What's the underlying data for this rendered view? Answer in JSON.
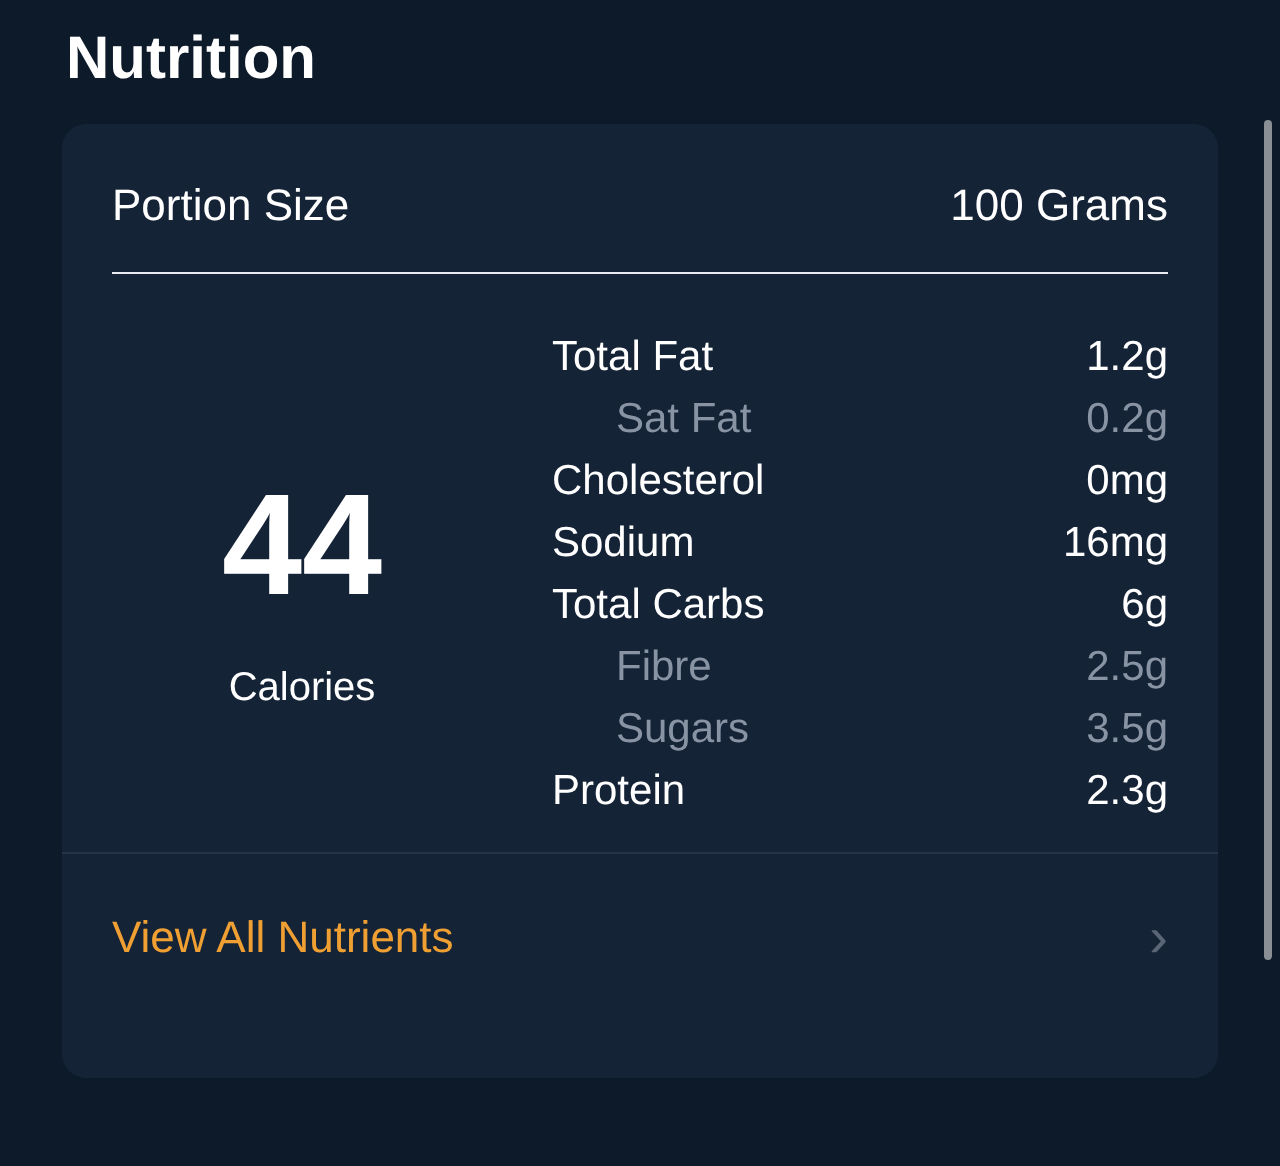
{
  "title": "Nutrition",
  "portion": {
    "label": "Portion Size",
    "value": "100 Grams"
  },
  "calories": {
    "value": "44",
    "label": "Calories"
  },
  "nutrients": [
    {
      "kind": "main",
      "name": "Total Fat",
      "amount": "1.2g"
    },
    {
      "kind": "sub",
      "name": "Sat Fat",
      "amount": "0.2g"
    },
    {
      "kind": "main",
      "name": "Cholesterol",
      "amount": "0mg"
    },
    {
      "kind": "main",
      "name": "Sodium",
      "amount": "16mg"
    },
    {
      "kind": "main",
      "name": "Total Carbs",
      "amount": "6g"
    },
    {
      "kind": "sub",
      "name": "Fibre",
      "amount": "2.5g"
    },
    {
      "kind": "sub",
      "name": "Sugars",
      "amount": "3.5g"
    },
    {
      "kind": "main",
      "name": "Protein",
      "amount": "2.3g"
    }
  ],
  "link": {
    "label": "View All Nutrients",
    "chevron": "›"
  }
}
